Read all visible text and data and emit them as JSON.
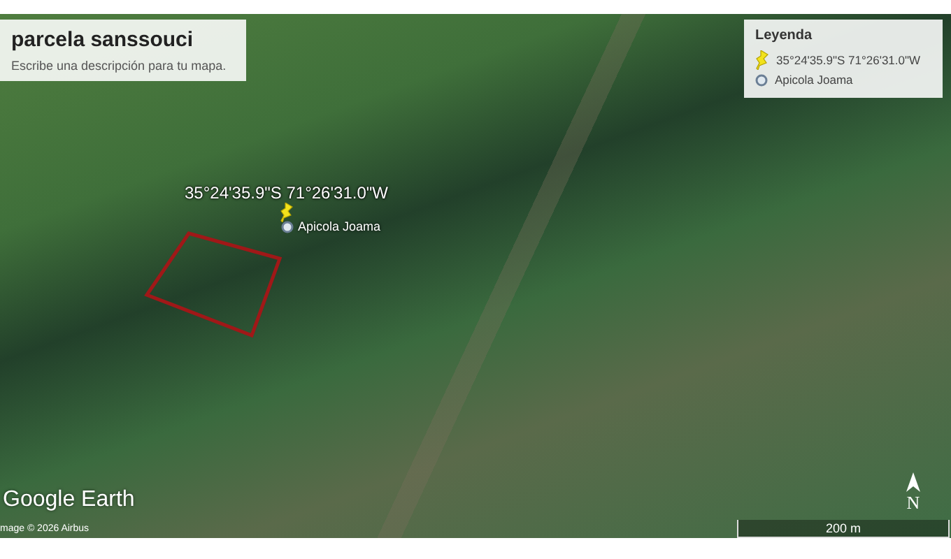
{
  "map": {
    "title": "parcela sanssouci",
    "description": "Escribe una descripción para tu mapa.",
    "legend": {
      "title": "Leyenda",
      "items": [
        {
          "kind": "pin",
          "label": "35°24'35.9\"S 71°26'31.0\"W"
        },
        {
          "kind": "place",
          "label": "Apicola Joama"
        }
      ]
    },
    "markers": [
      {
        "kind": "pin",
        "label": "35°24'35.9\"S 71°26'31.0\"W"
      },
      {
        "kind": "place",
        "label": "Apicola Joama"
      }
    ],
    "branding": "Google Earth",
    "credit": "mage © 2026 Airbus",
    "compass": "N",
    "scale": "200 m"
  }
}
